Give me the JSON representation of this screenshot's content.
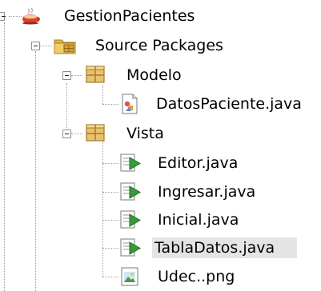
{
  "tree": {
    "project": {
      "label": "GestionPacientes",
      "icon": "java-project-cup-icon"
    },
    "source_packages": {
      "label": "Source Packages",
      "icon": "source-packages-folder-icon"
    },
    "packages": [
      {
        "label": "Modelo",
        "icon": "package-icon",
        "files": [
          {
            "label": "DatosPaciente.java",
            "icon": "java-class-icon"
          }
        ]
      },
      {
        "label": "Vista",
        "icon": "package-icon",
        "files": [
          {
            "label": "Editor.java",
            "icon": "jframe-form-icon"
          },
          {
            "label": "Ingresar.java",
            "icon": "jframe-form-icon"
          },
          {
            "label": "Inicial.java",
            "icon": "jframe-form-icon"
          },
          {
            "label": "TablaDatos.java",
            "icon": "jframe-form-icon",
            "selected": true
          },
          {
            "label": "Udec..png",
            "icon": "image-file-icon"
          }
        ]
      }
    ]
  },
  "colors": {
    "selection": "#e4e4e4",
    "guide_line": "#a0a0a0",
    "package_brown": "#c8a050",
    "form_green": "#3a9a3a"
  }
}
